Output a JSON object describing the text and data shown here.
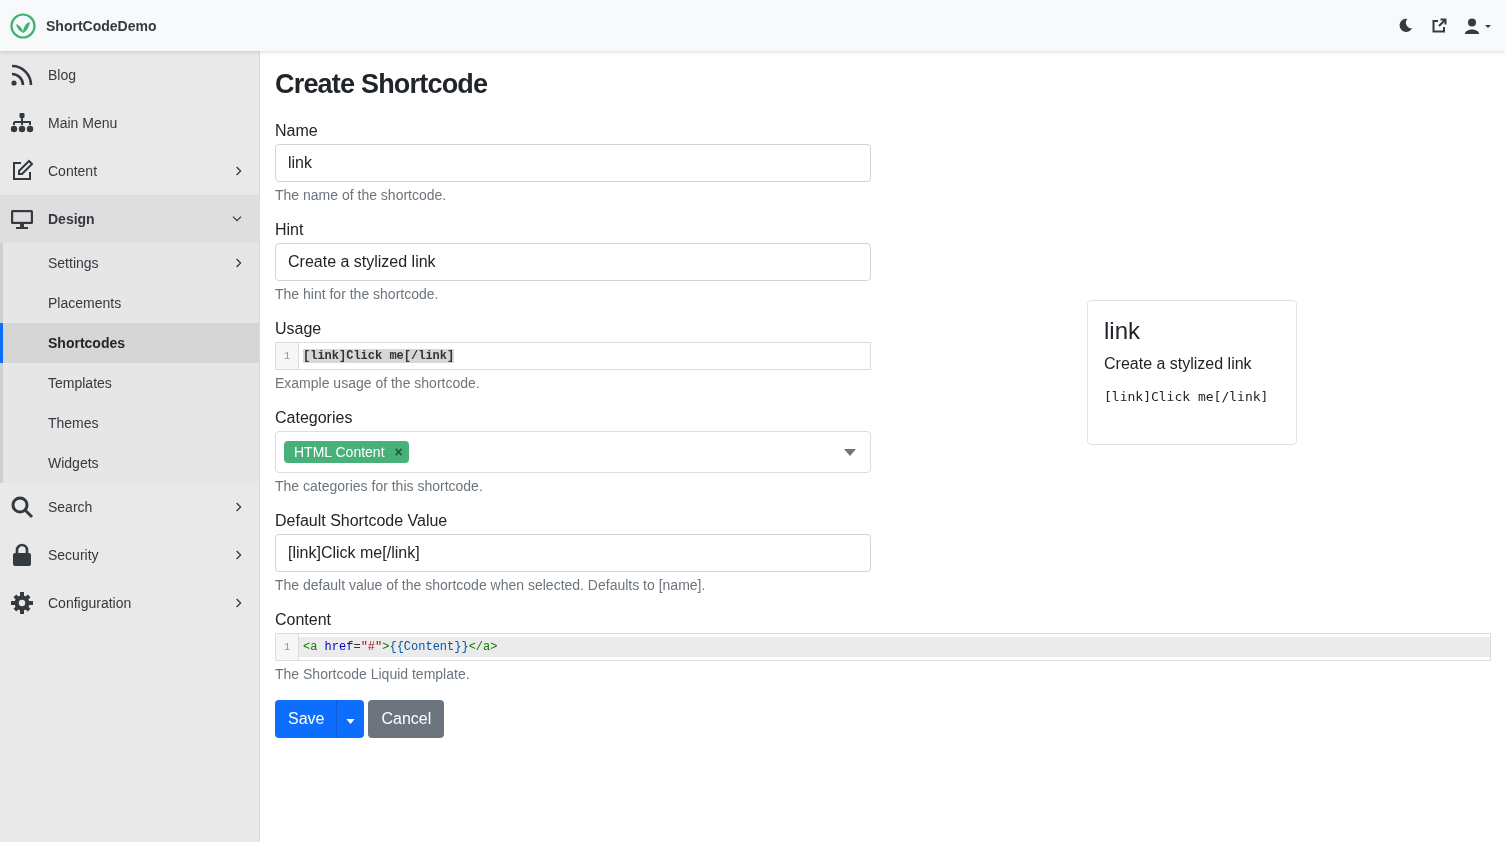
{
  "brand": {
    "name": "ShortCodeDemo"
  },
  "sidebar": {
    "items": [
      {
        "label": "Blog",
        "expandable": false,
        "expanded": false
      },
      {
        "label": "Main Menu",
        "expandable": false,
        "expanded": false
      },
      {
        "label": "Content",
        "expandable": true,
        "expanded": false
      },
      {
        "label": "Design",
        "expandable": true,
        "expanded": true,
        "children": [
          {
            "label": "Settings",
            "expandable": true,
            "selected": false
          },
          {
            "label": "Placements",
            "expandable": false,
            "selected": false
          },
          {
            "label": "Shortcodes",
            "expandable": false,
            "selected": true
          },
          {
            "label": "Templates",
            "expandable": false,
            "selected": false
          },
          {
            "label": "Themes",
            "expandable": false,
            "selected": false
          },
          {
            "label": "Widgets",
            "expandable": false,
            "selected": false
          }
        ]
      },
      {
        "label": "Search",
        "expandable": true,
        "expanded": false
      },
      {
        "label": "Security",
        "expandable": true,
        "expanded": false
      },
      {
        "label": "Configuration",
        "expandable": true,
        "expanded": false
      }
    ]
  },
  "page": {
    "title": "Create Shortcode"
  },
  "fields": [
    {
      "kind": "text",
      "label": "Name",
      "value": "link",
      "help": "The name of the shortcode."
    },
    {
      "kind": "text",
      "label": "Hint",
      "value": "Create a stylized link",
      "help": "The hint for the shortcode."
    },
    {
      "kind": "code",
      "label": "Usage",
      "line_number": "1",
      "tokens": [
        {
          "text": "[link]Click me[/link]",
          "kind": "selected"
        }
      ],
      "help": "Example usage of the shortcode."
    },
    {
      "kind": "tags",
      "label": "Categories",
      "tags": [
        {
          "label": "HTML Content",
          "remove": "×"
        }
      ],
      "help": "The categories for this shortcode."
    },
    {
      "kind": "text",
      "label": "Default Shortcode Value",
      "value": "[link]Click me[/link]",
      "help": "The default value of the shortcode when selected. Defaults to [name]."
    },
    {
      "kind": "template",
      "label": "Content",
      "line_number": "1",
      "tokens": [
        {
          "text": "<a",
          "kind": "tag"
        },
        {
          "text": " href",
          "kind": "attr"
        },
        {
          "text": "=",
          "kind": "plain"
        },
        {
          "text": "\"#\"",
          "kind": "string"
        },
        {
          "text": ">",
          "kind": "tag"
        },
        {
          "text": "{{Content}}",
          "kind": "variable"
        },
        {
          "text": "</a>",
          "kind": "tag"
        }
      ],
      "help": "The Shortcode Liquid template."
    }
  ],
  "buttons": {
    "save": "Save",
    "cancel": "Cancel"
  },
  "preview": {
    "title": "link",
    "hint": "Create a stylized link",
    "usage": "[link]Click me[/link]"
  }
}
